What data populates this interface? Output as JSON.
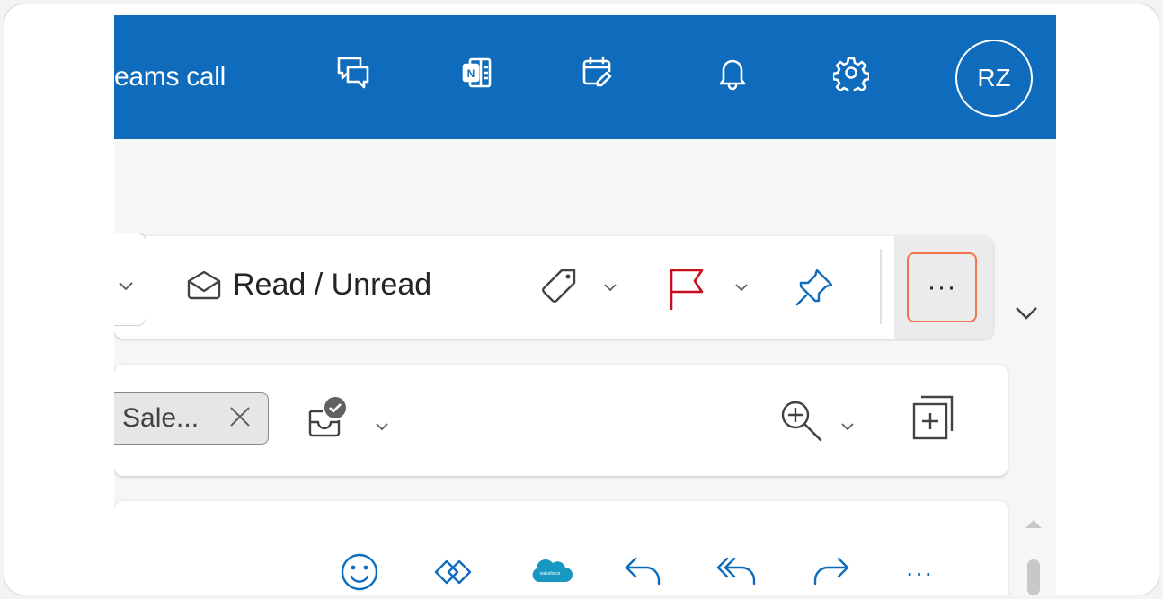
{
  "colors": {
    "accent_blue": "#0f6cbd",
    "flag_red": "#c50f1f",
    "highlight_border": "#f2734f"
  },
  "header": {
    "teams_call_label": "eams call",
    "icons": [
      "chat-reply-icon",
      "onenote-icon",
      "calendar-check-icon",
      "bell-icon",
      "gear-icon"
    ],
    "avatar_initials": "RZ"
  },
  "toolbar": {
    "read_unread_label": "Read / Unread",
    "more_label": "···"
  },
  "filter_bar": {
    "chip_label": "Sale..."
  },
  "message_actions": {
    "icons": [
      "smiley-icon",
      "viva-icon",
      "salesforce-icon",
      "reply-icon",
      "reply-all-icon",
      "forward-icon",
      "more-icon"
    ],
    "more_label": "···"
  }
}
